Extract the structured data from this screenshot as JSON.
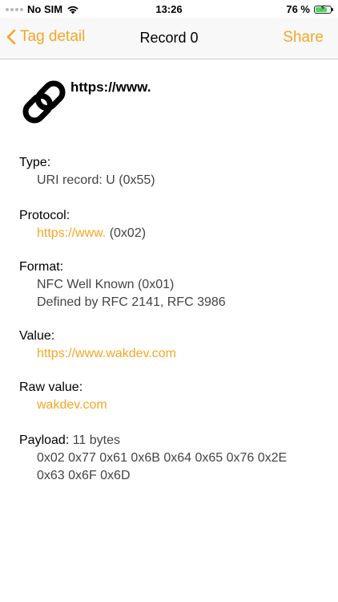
{
  "status_bar": {
    "carrier": "No SIM",
    "time": "13:26",
    "battery_text": "76 %",
    "battery_level": 0.76
  },
  "nav": {
    "back_label": "Tag detail",
    "title": "Record 0",
    "share_label": "Share"
  },
  "record": {
    "header_url": "https://www.",
    "type": {
      "label": "Type:",
      "value": "URI record: U (0x55)"
    },
    "protocol": {
      "label": "Protocol:",
      "link": "https://www.",
      "suffix": " (0x02)"
    },
    "format": {
      "label": "Format:",
      "line1": "NFC Well Known (0x01)",
      "line2": "Defined by RFC 2141, RFC 3986"
    },
    "value": {
      "label": "Value:",
      "link": "https://www.wakdev.com"
    },
    "raw_value": {
      "label": "Raw value:",
      "link": "wakdev.com"
    },
    "payload": {
      "label": "Payload:",
      "size": "11 bytes",
      "line1": "0x02 0x77 0x61 0x6B 0x64 0x65 0x76 0x2E",
      "line2": "0x63 0x6F 0x6D"
    }
  },
  "colors": {
    "accent": "#f5a623"
  }
}
